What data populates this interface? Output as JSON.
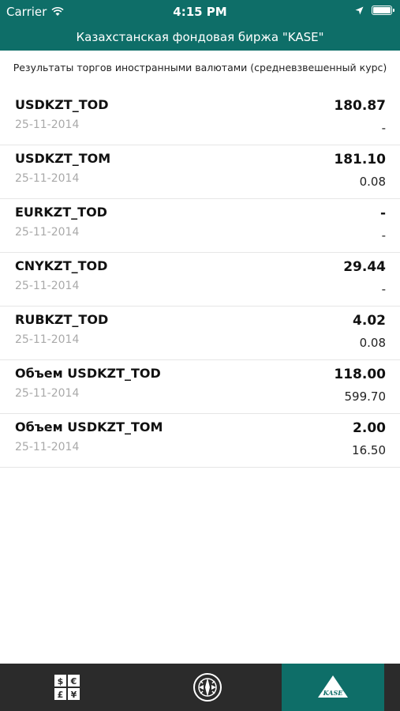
{
  "status_bar": {
    "carrier": "Carrier",
    "time": "4:15 PM",
    "battery_level": 1.0
  },
  "nav": {
    "title": "Казахстанская фондовая биржа \"KASE\""
  },
  "subtitle": "Результаты торгов иностранными валютами (средневзвешенный курс)",
  "rows": [
    {
      "name": "USDKZT_TOD",
      "date": "25-11-2014",
      "value": "180.87",
      "change": "-"
    },
    {
      "name": "USDKZT_TOM",
      "date": "25-11-2014",
      "value": "181.10",
      "change": "0.08"
    },
    {
      "name": "EURKZT_TOD",
      "date": "25-11-2014",
      "value": "-",
      "change": "-"
    },
    {
      "name": "CNYKZT_TOD",
      "date": "25-11-2014",
      "value": "29.44",
      "change": "-"
    },
    {
      "name": "RUBKZT_TOD",
      "date": "25-11-2014",
      "value": "4.02",
      "change": "0.08"
    },
    {
      "name": "Объем USDKZT_TOD",
      "date": "25-11-2014",
      "value": "118.00",
      "change": "599.70"
    },
    {
      "name": "Объем USDKZT_TOM",
      "date": "25-11-2014",
      "value": "2.00",
      "change": "16.50"
    }
  ],
  "tabbar": {
    "tabs": [
      {
        "icon": "currency-icon",
        "active": false
      },
      {
        "icon": "emblem-icon",
        "active": false
      },
      {
        "icon": "kase-logo-icon",
        "active": true,
        "logo_text": "KASE"
      }
    ]
  },
  "colors": {
    "primary": "#0e6e68",
    "tabbar_bg": "#2b2b2b",
    "date_text": "#a9a9a9"
  }
}
